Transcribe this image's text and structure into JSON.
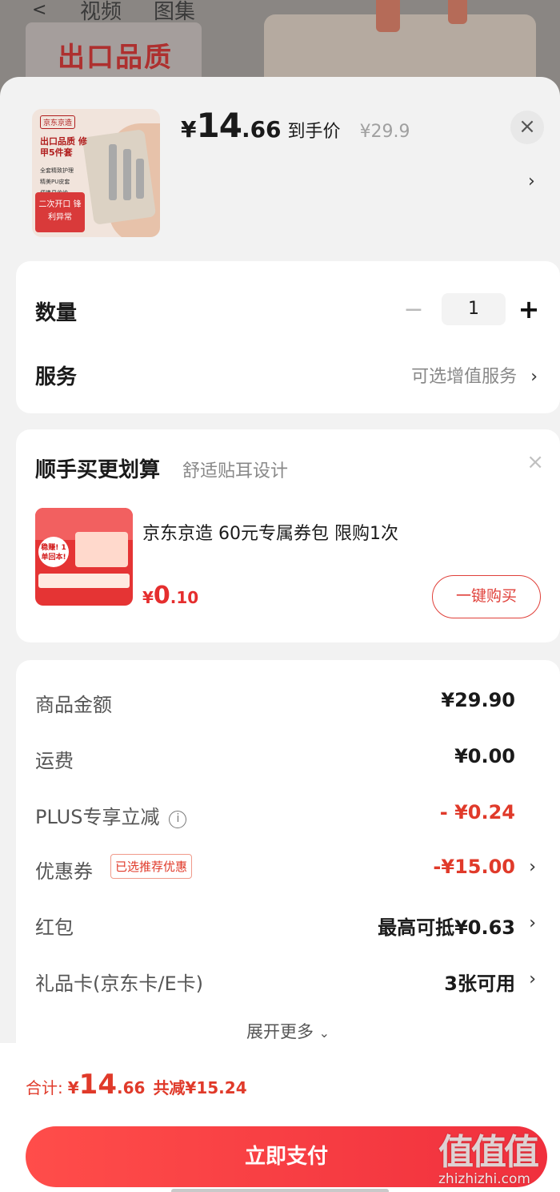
{
  "background": {
    "tabs": [
      "视频",
      "图集"
    ],
    "promo_text": "出口品质"
  },
  "product": {
    "thumb": {
      "logo": "京东京造",
      "headline": "出口品质 修甲5件套",
      "features": [
        "全套精致护理",
        "精美PU皮套",
        "便携易收纳"
      ],
      "badge": "二次开口 锋利异常"
    },
    "price_yen": "¥",
    "price_int": "14",
    "price_dec": ".66",
    "price_tag": "到手价",
    "original_price": "¥29.9"
  },
  "quantity": {
    "label": "数量",
    "value": "1",
    "minus": "−",
    "plus": "+"
  },
  "service": {
    "label": "服务",
    "value": "可选增值服务"
  },
  "upsell": {
    "title": "顺手买更划算",
    "subtitle": "舒适贴耳设计",
    "item_name": "京东京造 60元专属券包 限购1次",
    "price_yen": "¥",
    "price_int": "0",
    "price_dec": ".10",
    "buy_label": "一键购买",
    "image_badge": "稳赚! 1单回本!"
  },
  "fees": [
    {
      "label": "商品金额",
      "value": "¥29.90",
      "red": false,
      "chevron": false
    },
    {
      "label": "运费",
      "value": "¥0.00",
      "red": false,
      "chevron": false
    },
    {
      "label": "PLUS专享立减",
      "value": "- ¥0.24",
      "red": true,
      "chevron": false
    },
    {
      "label": "优惠券",
      "value": "-¥15.00",
      "red": true,
      "chevron": true,
      "tag": "已选推荐优惠"
    },
    {
      "label": "红包",
      "value": "最高可抵¥0.63",
      "red": false,
      "chevron": true
    },
    {
      "label": "礼品卡(京东卡/E卡)",
      "value": "3张可用",
      "red": false,
      "chevron": true
    }
  ],
  "expand_label": "展开更多",
  "footer": {
    "total_label": "合计:",
    "total_yen": "¥",
    "total_int": "14",
    "total_dec": ".66",
    "saved": "共减¥15.24",
    "pay_label": "立即支付"
  },
  "watermark": {
    "glyphs": "值值值",
    "url": "zhizhizhi.com"
  },
  "colors": {
    "accent_red": "#e03a2a",
    "pay_button": "#f0303d"
  }
}
